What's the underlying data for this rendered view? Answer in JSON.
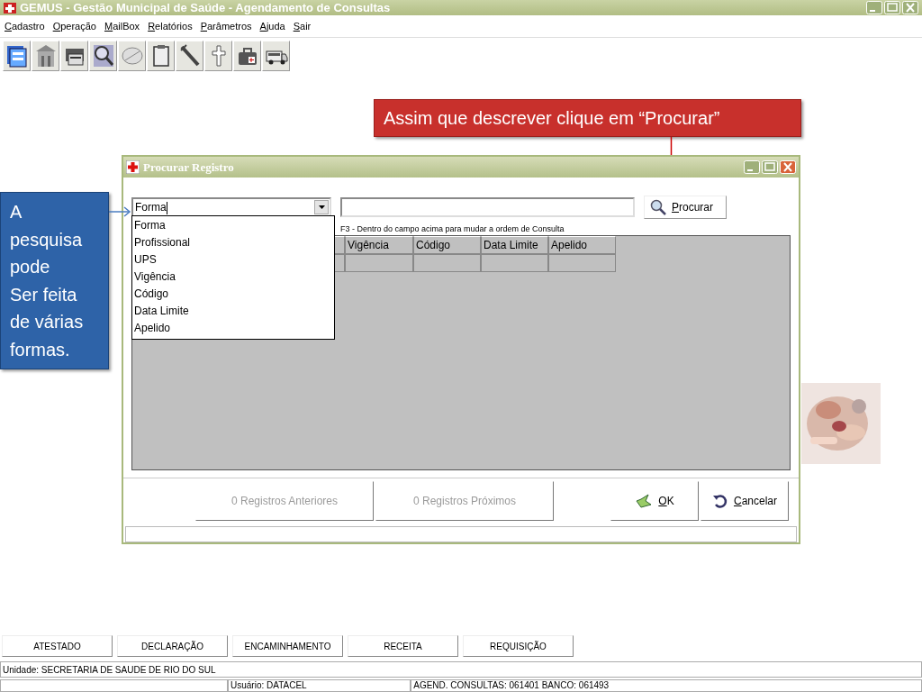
{
  "window": {
    "title": "GEMUS - Gestão Municipal de Saúde - Agendamento de Consultas"
  },
  "menu": [
    "Cadastro",
    "Operação",
    "MailBox",
    "Relatórios",
    "Parâmetros",
    "Ajuda",
    "Sair"
  ],
  "dialog": {
    "title": "Procurar Registro",
    "search_by": {
      "value": "Forma",
      "expanded": true,
      "options": [
        "Forma",
        "Profissional",
        "UPS",
        "Vigência",
        "Código",
        "Data Limite",
        "Apelido"
      ]
    },
    "search_button": "Procurar",
    "hint": "F3 - Dentro do campo acima para mudar a ordem de Consulta",
    "table": {
      "columns": [
        "Vigência",
        "Código",
        "Data Limite",
        "Apelido"
      ]
    },
    "footer_buttons": [
      {
        "label": "0 Registros Anteriores",
        "kind": "nav",
        "disabled": true
      },
      {
        "label": "0 Registros Próximos",
        "kind": "nav",
        "disabled": true
      },
      {
        "label": "OK",
        "kind": "ok",
        "disabled": false
      },
      {
        "label": "Cancelar",
        "kind": "cancel",
        "disabled": false
      }
    ]
  },
  "callouts": {
    "procurar": "Assim que descrever clique em “Procurar”",
    "search_modes": "A\npesquisa\npode\nSer feita\nde várias\nformas."
  },
  "bottom_buttons": [
    "ATESTADO",
    "DECLARAÇÃO",
    "ENCAMINHAMENTO",
    "RECEITA",
    "REQUISIÇÃO"
  ],
  "status_bar": {
    "unit": "Unidade: SECRETARIA DE SAUDE DE RIO DO SUL",
    "user": "Usuário: DATACEL",
    "info": "AGEND. CONSULTAS: 061401 BANCO: 061493"
  }
}
